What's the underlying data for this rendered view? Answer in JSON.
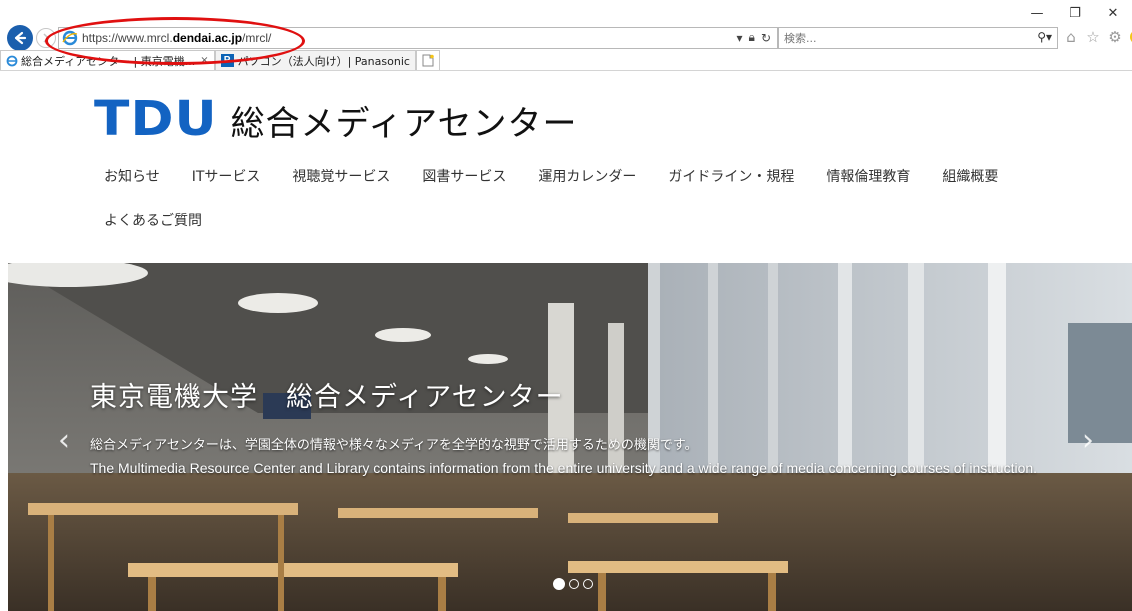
{
  "browser": {
    "url_prefix": "https://www.mrcl.",
    "url_domain": "dendai.ac.jp",
    "url_path": "/mrcl/",
    "search_placeholder": "検索...",
    "window_controls": [
      "—",
      "❐",
      "✕"
    ],
    "tabs": [
      {
        "label": "総合メディアセンター | 東京電機...",
        "close": "×",
        "icon": "ie-icon",
        "active": true
      },
      {
        "label": "パソコン（法人向け）| Panasonic",
        "icon": "panasonic-p-icon",
        "favicon_text": "P",
        "active": false
      }
    ],
    "annotation_color": "#e01010"
  },
  "site": {
    "logo_mark": "TDU",
    "logo_name": "総合メディアセンター",
    "brand_color": "#1363c2",
    "nav": [
      "お知らせ",
      "ITサービス",
      "視聴覚サービス",
      "図書サービス",
      "運用カレンダー",
      "ガイドライン・規程",
      "情報倫理教育",
      "組織概要",
      "よくあるご質問"
    ]
  },
  "hero": {
    "title": "東京電機大学　総合メディアセンター",
    "description_jp": "総合メディアセンターは、学園全体の情報や様々なメディアを全学的な視野で活用するための機関です。",
    "description_en": "The Multimedia Resource Center and Library contains information from the entire university and a wide range of media concerning courses of instruction.",
    "prev_arrow": "‹",
    "next_arrow": "›",
    "slide_count": 3,
    "active_slide": 1
  }
}
